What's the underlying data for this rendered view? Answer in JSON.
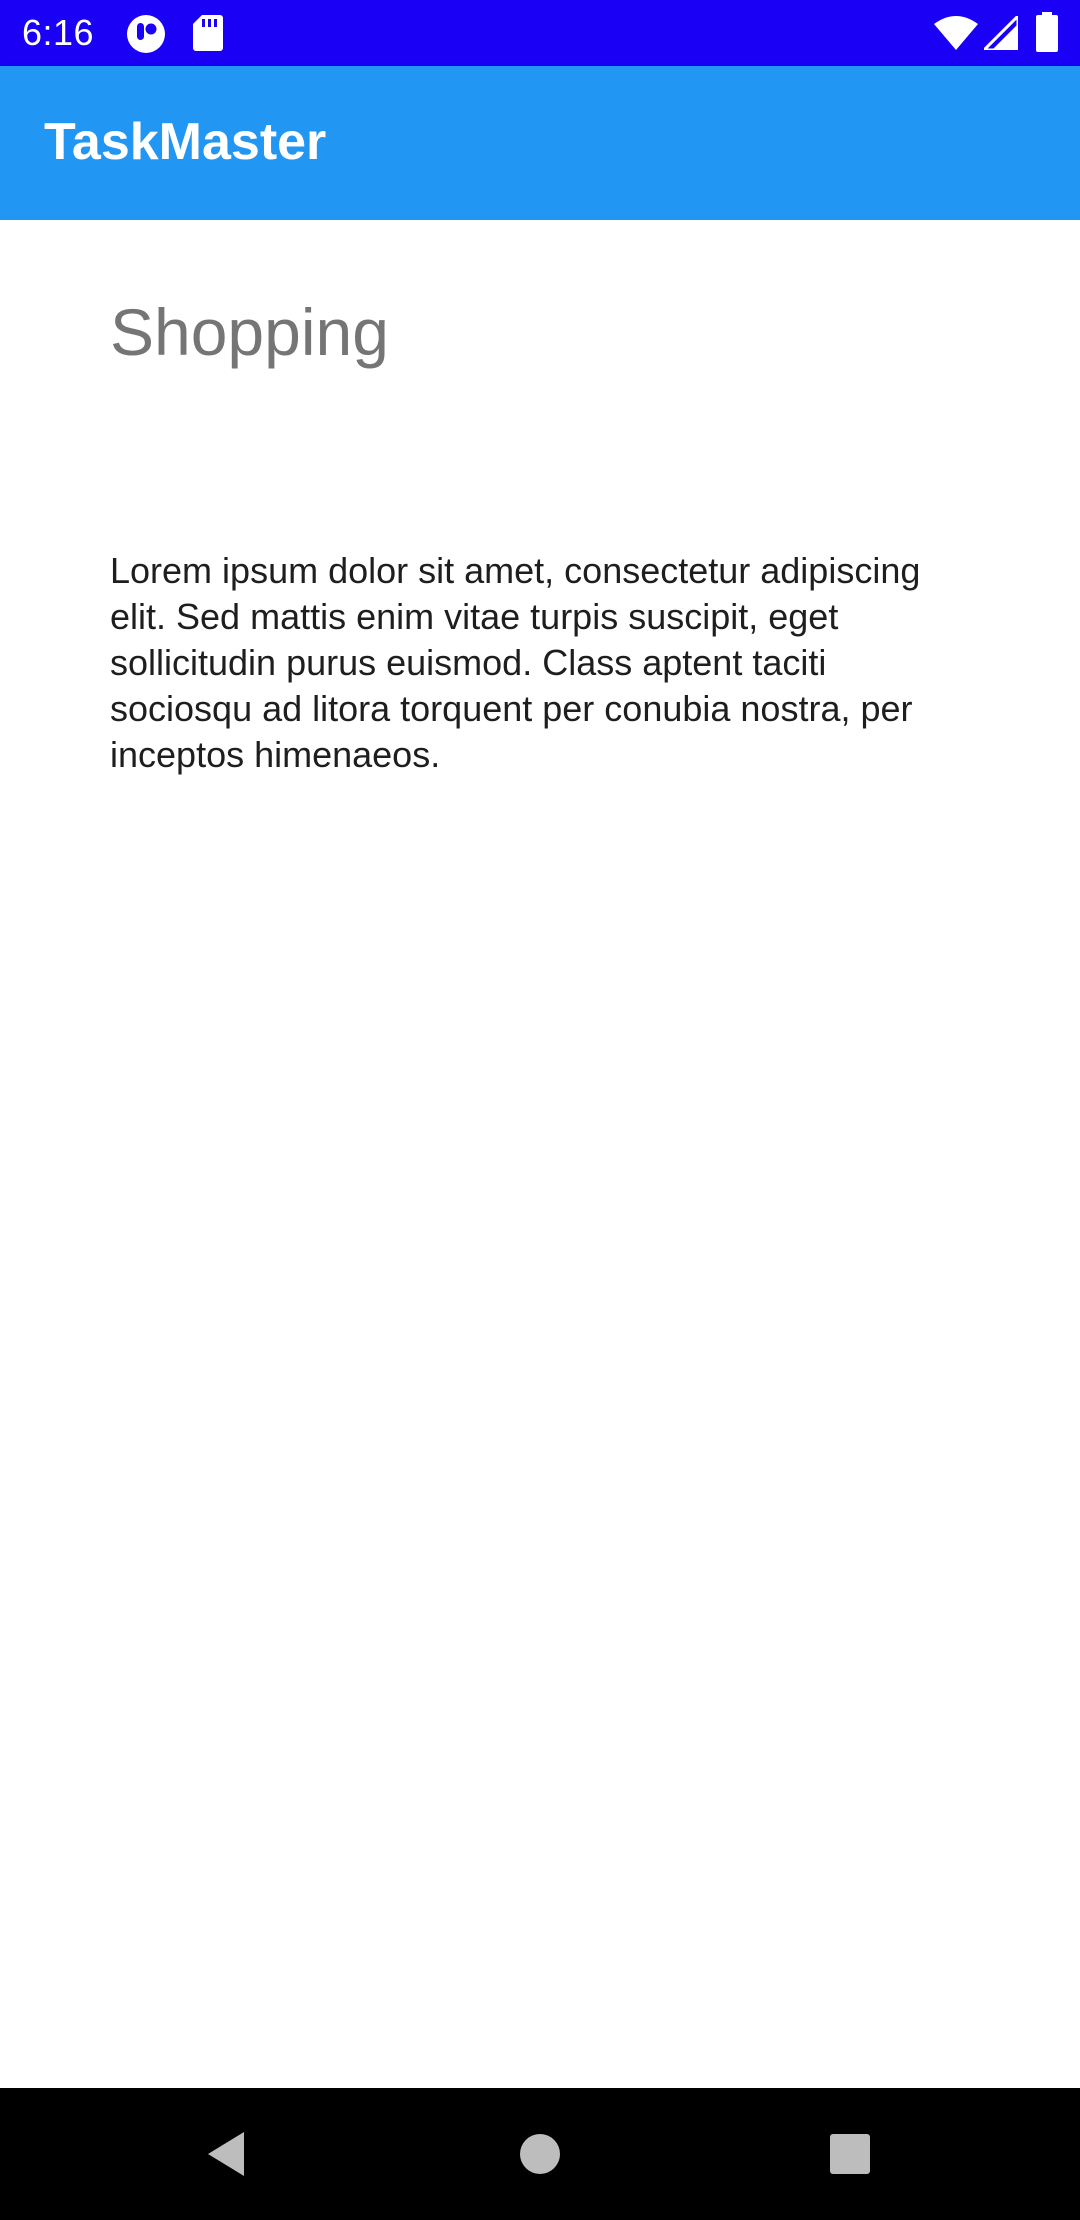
{
  "status_bar": {
    "time": "6:16",
    "icons": [
      "notification-app-icon",
      "sd-card-icon",
      "wifi-icon",
      "cell-signal-icon",
      "battery-icon"
    ]
  },
  "app_bar": {
    "title": "TaskMaster"
  },
  "task": {
    "title": "Shopping",
    "body": "Lorem ipsum dolor sit amet, consectetur adipiscing elit. Sed mattis enim vitae turpis suscipit, eget sollicitudin purus euismod. Class aptent taciti sociosqu ad litora torquent per conubia nostra, per inceptos himenaeos."
  },
  "nav_bar": {
    "buttons": [
      "back-icon",
      "home-icon",
      "recents-icon"
    ]
  },
  "colors": {
    "status_bar": "#1a00f5",
    "app_bar": "#2196f3",
    "task_title": "#757575",
    "task_body": "#1e1e1e",
    "nav_bar": "#000000",
    "nav_icon": "#bdbdbd"
  }
}
